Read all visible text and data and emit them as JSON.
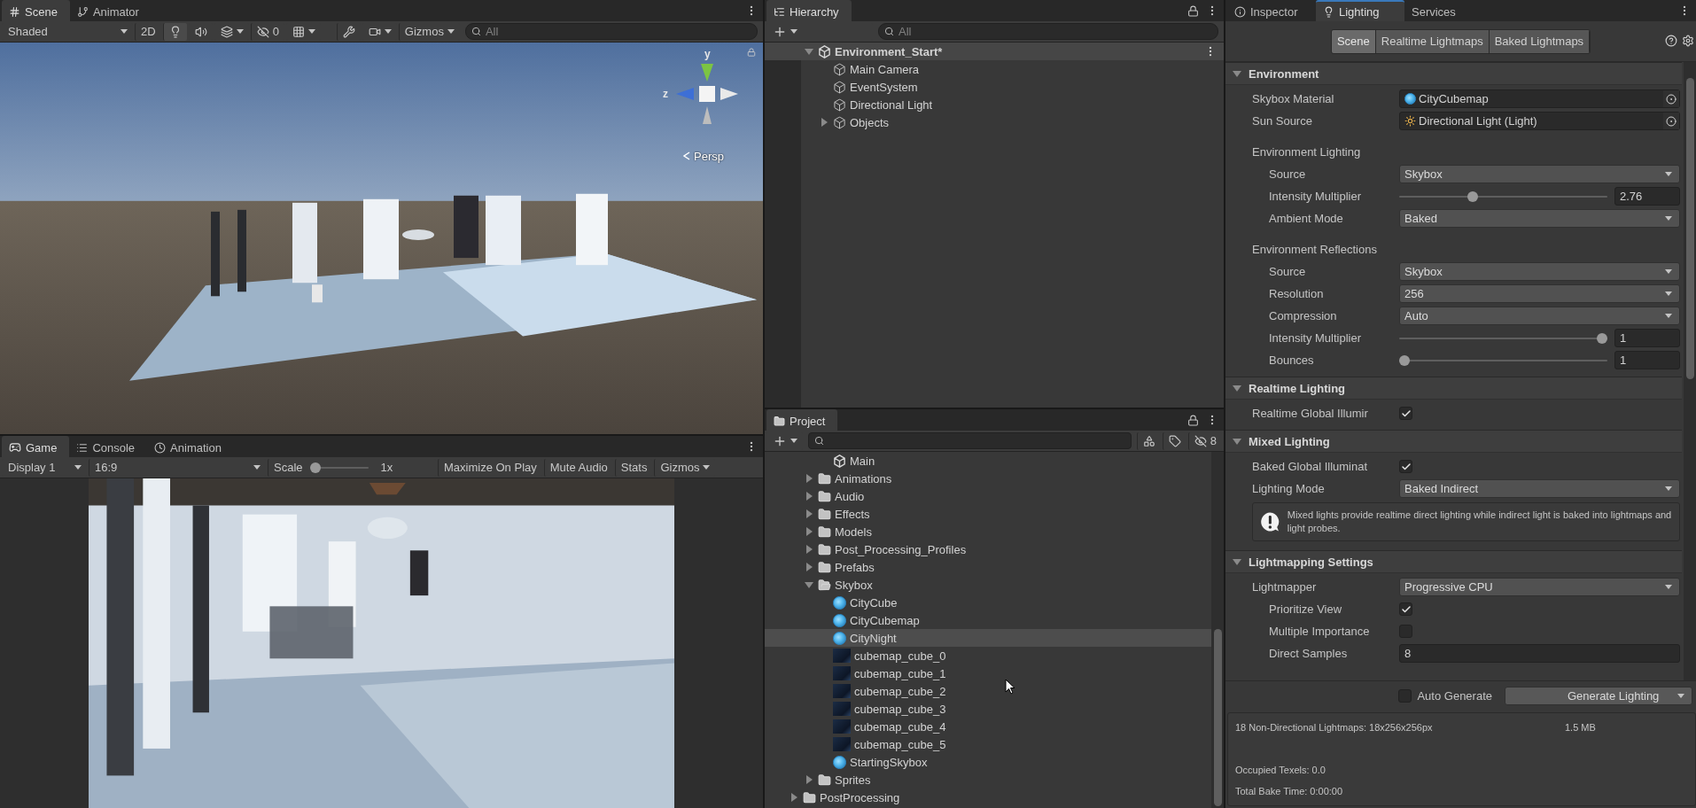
{
  "scene_panel": {
    "tabs": [
      {
        "label": "Scene",
        "kind": "scene",
        "selected": true
      },
      {
        "label": "Animator",
        "kind": "animator",
        "selected": false
      }
    ],
    "toolbar": {
      "shading": "Shaded",
      "mode_2d": "2D",
      "lighting_on": true,
      "hidden_count": "0",
      "gizmos": "Gizmos",
      "search_placeholder": "All"
    },
    "gizmo": {
      "y_label": "y",
      "z_label": "z",
      "projection": "Persp"
    }
  },
  "game_panel": {
    "tabs": [
      {
        "label": "Game",
        "kind": "game",
        "selected": true
      },
      {
        "label": "Console",
        "kind": "console",
        "selected": false
      },
      {
        "label": "Animation",
        "kind": "animation",
        "selected": false
      }
    ],
    "toolbar": {
      "display": "Display 1",
      "aspect": "16:9",
      "scale": {
        "label": "Scale",
        "level": 0,
        "reading": "1x"
      },
      "buttons": [
        "Maximize On Play",
        "Mute Audio",
        "Stats"
      ],
      "gizmos": "Gizmos"
    }
  },
  "hierarchy": {
    "title": "Hierarchy",
    "search_placeholder": "All",
    "scene": {
      "name": "Environment_Start*",
      "expanded": true,
      "children": [
        {
          "name": "Main Camera"
        },
        {
          "name": "EventSystem"
        },
        {
          "name": "Directional Light"
        },
        {
          "name": "Objects",
          "expanded": false
        }
      ]
    }
  },
  "project": {
    "title": "Project",
    "hidden_count": "8",
    "tree": [
      {
        "children": [
          {
            "children": [
              {
                "name": "Main",
                "kind": "scene",
                "selected": false
              }
            ]
          },
          {
            "name": "Animations",
            "kind": "folder",
            "expanded": false,
            "selected": false
          },
          {
            "name": "Audio",
            "kind": "folder",
            "expanded": false,
            "selected": false
          },
          {
            "name": "Effects",
            "kind": "folder",
            "expanded": false,
            "selected": false
          },
          {
            "name": "Models",
            "kind": "folder",
            "expanded": false,
            "selected": false
          },
          {
            "name": "Post_Processing_Profiles",
            "kind": "folder",
            "expanded": false,
            "selected": false
          },
          {
            "name": "Prefabs",
            "kind": "folder",
            "expanded": false,
            "selected": false
          },
          {
            "name": "Skybox",
            "kind": "folder",
            "expanded": true,
            "selected": false,
            "children": [
              {
                "name": "CityCube",
                "kind": "material",
                "selected": false
              },
              {
                "name": "CityCubemap",
                "kind": "material",
                "selected": false
              },
              {
                "name": "CityNight",
                "kind": "material",
                "selected": true
              },
              {
                "name": "cubemap_cube_0",
                "kind": "texture",
                "selected": false
              },
              {
                "name": "cubemap_cube_1",
                "kind": "texture",
                "selected": false
              },
              {
                "name": "cubemap_cube_2",
                "kind": "texture",
                "selected": false
              },
              {
                "name": "cubemap_cube_3",
                "kind": "texture",
                "selected": false
              },
              {
                "name": "cubemap_cube_4",
                "kind": "texture",
                "selected": false
              },
              {
                "name": "cubemap_cube_5",
                "kind": "texture",
                "selected": false
              },
              {
                "name": "StartingSkybox",
                "kind": "material",
                "selected": false
              }
            ]
          },
          {
            "name": "Sprites",
            "kind": "folder",
            "expanded": false,
            "selected": false
          }
        ]
      },
      {
        "name": "PostProcessing",
        "kind": "folder",
        "expanded": false,
        "selected": false
      }
    ]
  },
  "inspector": {
    "tabs": [
      {
        "label": "Inspector",
        "kind": "info",
        "selected": false
      },
      {
        "label": "Lighting",
        "kind": "light",
        "selected": true
      },
      {
        "label": "Services",
        "kind": "plain",
        "selected": false
      }
    ],
    "subtabs": [
      {
        "label": "Scene",
        "selected": true
      },
      {
        "label": "Realtime Lightmaps",
        "selected": false
      },
      {
        "label": "Baked Lightmaps",
        "selected": false
      }
    ],
    "sections": [
      {
        "title": "Environment",
        "expanded": true,
        "rows": [
          {
            "kind": "object",
            "label": "Skybox Material",
            "value": {
              "kind": "material",
              "text": "CityCubemap"
            }
          },
          {
            "kind": "object",
            "label": "Sun Source",
            "value": {
              "kind": "light",
              "text": "Directional Light (Light)"
            }
          },
          {
            "kind": "group",
            "label": "Environment Lighting",
            "rows": [
              {
                "kind": "dropdown",
                "label": "Source",
                "value": "Skybox"
              },
              {
                "kind": "slider",
                "label": "Intensity Multiplier",
                "level": 0.345,
                "reading": "2.76"
              },
              {
                "kind": "dropdown",
                "label": "Ambient Mode",
                "value": "Baked"
              }
            ]
          },
          {
            "kind": "group",
            "label": "Environment Reflections",
            "rows": [
              {
                "kind": "dropdown",
                "label": "Source",
                "value": "Skybox"
              },
              {
                "kind": "dropdown",
                "label": "Resolution",
                "value": "256"
              },
              {
                "kind": "dropdown",
                "label": "Compression",
                "value": "Auto"
              },
              {
                "kind": "slider",
                "label": "Intensity Multiplier",
                "level": 1,
                "reading": "1"
              },
              {
                "kind": "slider",
                "label": "Bounces",
                "level": 0,
                "reading": "1"
              }
            ]
          }
        ]
      },
      {
        "title": "Realtime Lighting",
        "expanded": true,
        "rows": [
          {
            "kind": "checkbox",
            "label": "Realtime Global Illumir",
            "checked": true
          }
        ]
      },
      {
        "title": "Mixed Lighting",
        "expanded": true,
        "rows": [
          {
            "kind": "checkbox",
            "label": "Baked Global Illuminat",
            "checked": true
          },
          {
            "kind": "dropdown",
            "label": "Lighting Mode",
            "value": "Baked Indirect"
          },
          {
            "kind": "help",
            "text": "Mixed lights provide realtime direct lighting while indirect light is baked into lightmaps and light probes."
          }
        ]
      },
      {
        "title": "Lightmapping Settings",
        "expanded": true,
        "rows": [
          {
            "kind": "dropdown",
            "label": "Lightmapper",
            "value": "Progressive CPU"
          },
          {
            "kind": "group",
            "rows": [
              {
                "kind": "checkbox",
                "label": "Prioritize View",
                "checked": true
              },
              {
                "kind": "checkbox",
                "label": "Multiple Importance",
                "checked": false
              },
              {
                "kind": "number",
                "label": "Direct Samples",
                "value": "8"
              }
            ]
          }
        ]
      }
    ],
    "footer": {
      "auto_generate": {
        "label": "Auto Generate",
        "checked": false
      },
      "generate": "Generate Lighting"
    },
    "stats": {
      "lightmaps": "18 Non-Directional Lightmaps: 18x256x256px",
      "size": "1.5 MB",
      "texels": "Occupied Texels: 0.0",
      "bake_time": "Total Bake Time: 0:00:00"
    }
  }
}
